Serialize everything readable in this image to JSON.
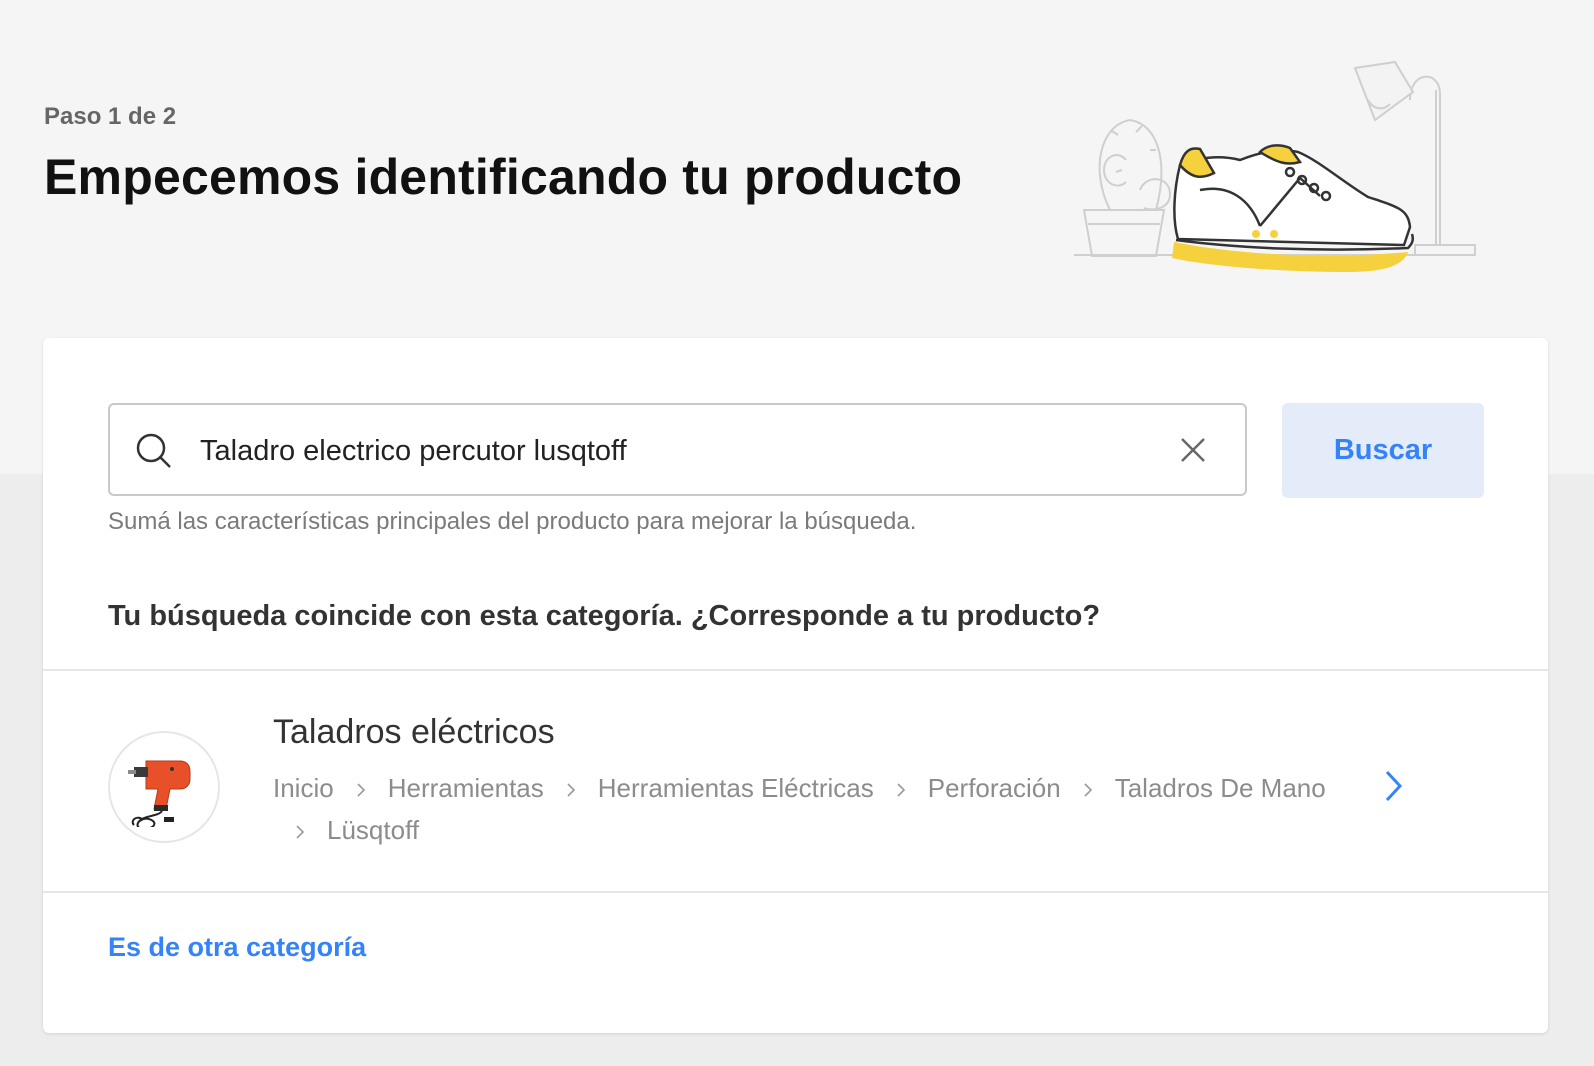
{
  "header": {
    "step": "Paso 1 de 2",
    "title": "Empecemos identificando tu producto"
  },
  "search": {
    "value": "Taladro electrico percutor lusqtoff",
    "button_label": "Buscar",
    "hint": "Sumá las características principales del producto para mejorar la búsqueda."
  },
  "result": {
    "question": "Tu búsqueda coincide con esta categoría. ¿Corresponde a tu producto?",
    "category_name": "Taladros eléctricos",
    "breadcrumb": [
      "Inicio",
      "Herramientas",
      "Herramientas Eléctricas",
      "Perforación",
      "Taladros De Mano",
      "Lüsqtoff"
    ]
  },
  "other_category_link": "Es de otra categoría",
  "colors": {
    "accent": "#3483fa",
    "button_bg": "#e4ecfa",
    "illustration_yellow": "#f5d23d"
  },
  "icons": [
    "search-icon",
    "close-icon",
    "chevron-right-icon",
    "breadcrumb-chevron-icon",
    "drill-product-image",
    "sneaker-illustration"
  ]
}
